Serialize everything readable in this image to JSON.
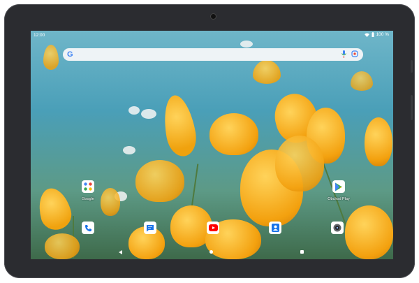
{
  "status_bar": {
    "time": "12:00",
    "battery": "100 %"
  },
  "search": {
    "logo": "G"
  },
  "apps": {
    "google": {
      "label": "Google"
    },
    "play": {
      "label": "Obchod Play"
    }
  },
  "dock": [
    "phone",
    "messages",
    "youtube",
    "contacts",
    "camera"
  ],
  "colors": {
    "bezel": "#2b2c30",
    "search_bg": "#eef3f6",
    "accent_yellow": "#f3a10f"
  }
}
